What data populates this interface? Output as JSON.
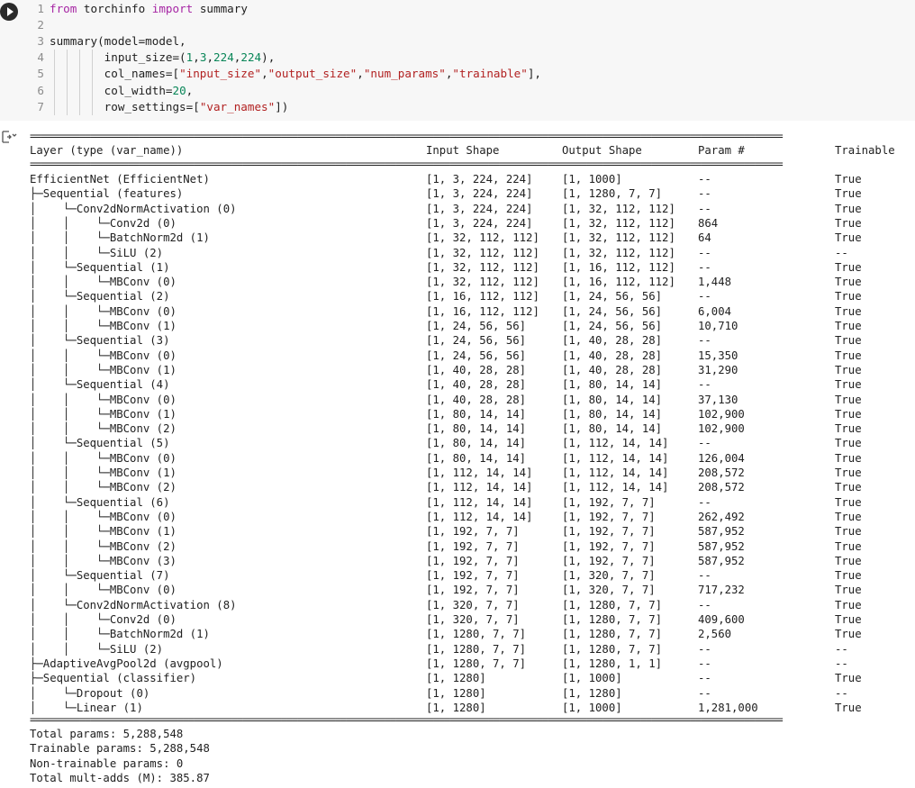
{
  "code_cell": {
    "lines": [
      {
        "num": "1",
        "parts": [
          [
            "kw",
            "from"
          ],
          [
            "t",
            " torchinfo "
          ],
          [
            "kw",
            "import"
          ],
          [
            "t",
            " summary"
          ]
        ]
      },
      {
        "num": "2",
        "parts": []
      },
      {
        "num": "3",
        "parts": [
          [
            "t",
            "summary(model=model,"
          ]
        ]
      },
      {
        "num": "4",
        "parts": [
          [
            "t",
            "        input_size=("
          ],
          [
            "num",
            "1"
          ],
          [
            "t",
            ","
          ],
          [
            "num",
            "3"
          ],
          [
            "t",
            ","
          ],
          [
            "num",
            "224"
          ],
          [
            "t",
            ","
          ],
          [
            "num",
            "224"
          ],
          [
            "t",
            "),"
          ]
        ]
      },
      {
        "num": "5",
        "parts": [
          [
            "t",
            "        col_names=["
          ],
          [
            "str",
            "\"input_size\""
          ],
          [
            "t",
            ","
          ],
          [
            "str",
            "\"output_size\""
          ],
          [
            "t",
            ","
          ],
          [
            "str",
            "\"num_params\""
          ],
          [
            "t",
            ","
          ],
          [
            "str",
            "\"trainable\""
          ],
          [
            "t",
            "],"
          ]
        ]
      },
      {
        "num": "6",
        "parts": [
          [
            "t",
            "        col_width="
          ],
          [
            "num",
            "20"
          ],
          [
            "t",
            ","
          ]
        ]
      },
      {
        "num": "7",
        "parts": [
          [
            "t",
            "        row_settings=["
          ],
          [
            "str",
            "\"var_names\""
          ],
          [
            "t",
            "])"
          ]
        ]
      }
    ]
  },
  "output": {
    "separator": "==========================================================================================================================================",
    "header": [
      "Layer (type (var_name))",
      "Input Shape",
      "Output Shape",
      "Param #",
      "Trainable"
    ],
    "rows": [
      [
        "EfficientNet (EfficientNet)",
        "[1, 3, 224, 224]",
        "[1, 1000]",
        "--",
        "True"
      ],
      [
        "├─Sequential (features)",
        "[1, 3, 224, 224]",
        "[1, 1280, 7, 7]",
        "--",
        "True"
      ],
      [
        "│    └─Conv2dNormActivation (0)",
        "[1, 3, 224, 224]",
        "[1, 32, 112, 112]",
        "--",
        "True"
      ],
      [
        "│    │    └─Conv2d (0)",
        "[1, 3, 224, 224]",
        "[1, 32, 112, 112]",
        "864",
        "True"
      ],
      [
        "│    │    └─BatchNorm2d (1)",
        "[1, 32, 112, 112]",
        "[1, 32, 112, 112]",
        "64",
        "True"
      ],
      [
        "│    │    └─SiLU (2)",
        "[1, 32, 112, 112]",
        "[1, 32, 112, 112]",
        "--",
        "--"
      ],
      [
        "│    └─Sequential (1)",
        "[1, 32, 112, 112]",
        "[1, 16, 112, 112]",
        "--",
        "True"
      ],
      [
        "│    │    └─MBConv (0)",
        "[1, 32, 112, 112]",
        "[1, 16, 112, 112]",
        "1,448",
        "True"
      ],
      [
        "│    └─Sequential (2)",
        "[1, 16, 112, 112]",
        "[1, 24, 56, 56]",
        "--",
        "True"
      ],
      [
        "│    │    └─MBConv (0)",
        "[1, 16, 112, 112]",
        "[1, 24, 56, 56]",
        "6,004",
        "True"
      ],
      [
        "│    │    └─MBConv (1)",
        "[1, 24, 56, 56]",
        "[1, 24, 56, 56]",
        "10,710",
        "True"
      ],
      [
        "│    └─Sequential (3)",
        "[1, 24, 56, 56]",
        "[1, 40, 28, 28]",
        "--",
        "True"
      ],
      [
        "│    │    └─MBConv (0)",
        "[1, 24, 56, 56]",
        "[1, 40, 28, 28]",
        "15,350",
        "True"
      ],
      [
        "│    │    └─MBConv (1)",
        "[1, 40, 28, 28]",
        "[1, 40, 28, 28]",
        "31,290",
        "True"
      ],
      [
        "│    └─Sequential (4)",
        "[1, 40, 28, 28]",
        "[1, 80, 14, 14]",
        "--",
        "True"
      ],
      [
        "│    │    └─MBConv (0)",
        "[1, 40, 28, 28]",
        "[1, 80, 14, 14]",
        "37,130",
        "True"
      ],
      [
        "│    │    └─MBConv (1)",
        "[1, 80, 14, 14]",
        "[1, 80, 14, 14]",
        "102,900",
        "True"
      ],
      [
        "│    │    └─MBConv (2)",
        "[1, 80, 14, 14]",
        "[1, 80, 14, 14]",
        "102,900",
        "True"
      ],
      [
        "│    └─Sequential (5)",
        "[1, 80, 14, 14]",
        "[1, 112, 14, 14]",
        "--",
        "True"
      ],
      [
        "│    │    └─MBConv (0)",
        "[1, 80, 14, 14]",
        "[1, 112, 14, 14]",
        "126,004",
        "True"
      ],
      [
        "│    │    └─MBConv (1)",
        "[1, 112, 14, 14]",
        "[1, 112, 14, 14]",
        "208,572",
        "True"
      ],
      [
        "│    │    └─MBConv (2)",
        "[1, 112, 14, 14]",
        "[1, 112, 14, 14]",
        "208,572",
        "True"
      ],
      [
        "│    └─Sequential (6)",
        "[1, 112, 14, 14]",
        "[1, 192, 7, 7]",
        "--",
        "True"
      ],
      [
        "│    │    └─MBConv (0)",
        "[1, 112, 14, 14]",
        "[1, 192, 7, 7]",
        "262,492",
        "True"
      ],
      [
        "│    │    └─MBConv (1)",
        "[1, 192, 7, 7]",
        "[1, 192, 7, 7]",
        "587,952",
        "True"
      ],
      [
        "│    │    └─MBConv (2)",
        "[1, 192, 7, 7]",
        "[1, 192, 7, 7]",
        "587,952",
        "True"
      ],
      [
        "│    │    └─MBConv (3)",
        "[1, 192, 7, 7]",
        "[1, 192, 7, 7]",
        "587,952",
        "True"
      ],
      [
        "│    └─Sequential (7)",
        "[1, 192, 7, 7]",
        "[1, 320, 7, 7]",
        "--",
        "True"
      ],
      [
        "│    │    └─MBConv (0)",
        "[1, 192, 7, 7]",
        "[1, 320, 7, 7]",
        "717,232",
        "True"
      ],
      [
        "│    └─Conv2dNormActivation (8)",
        "[1, 320, 7, 7]",
        "[1, 1280, 7, 7]",
        "--",
        "True"
      ],
      [
        "│    │    └─Conv2d (0)",
        "[1, 320, 7, 7]",
        "[1, 1280, 7, 7]",
        "409,600",
        "True"
      ],
      [
        "│    │    └─BatchNorm2d (1)",
        "[1, 1280, 7, 7]",
        "[1, 1280, 7, 7]",
        "2,560",
        "True"
      ],
      [
        "│    │    └─SiLU (2)",
        "[1, 1280, 7, 7]",
        "[1, 1280, 7, 7]",
        "--",
        "--"
      ],
      [
        "├─AdaptiveAvgPool2d (avgpool)",
        "[1, 1280, 7, 7]",
        "[1, 1280, 1, 1]",
        "--",
        "--"
      ],
      [
        "├─Sequential (classifier)",
        "[1, 1280]",
        "[1, 1000]",
        "--",
        "True"
      ],
      [
        "│    └─Dropout (0)",
        "[1, 1280]",
        "[1, 1280]",
        "--",
        "--"
      ],
      [
        "│    └─Linear (1)",
        "[1, 1280]",
        "[1, 1000]",
        "1,281,000",
        "True"
      ]
    ],
    "totals": [
      "Total params: 5,288,548",
      "Trainable params: 5,288,548",
      "Non-trainable params: 0",
      "Total mult-adds (M): 385.87"
    ]
  }
}
